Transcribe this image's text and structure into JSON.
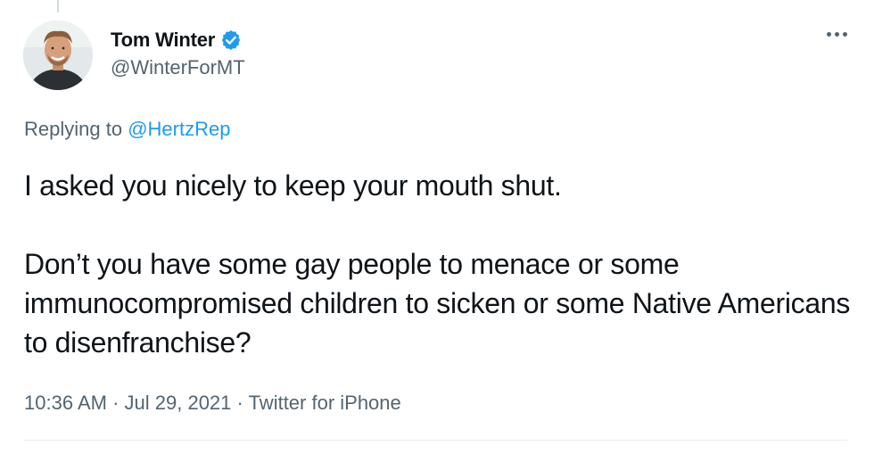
{
  "tweet": {
    "author": {
      "name": "Tom Winter",
      "handle": "@WinterForMT",
      "verified_icon": "verified-badge-icon",
      "avatar_icon": "profile-photo"
    },
    "replying_prefix": "Replying to",
    "replying_to": "@HertzRep",
    "paragraphs": [
      "I asked you nicely to keep your mouth shut.",
      "Don’t you have some gay people to menace or some immunocompromised children to sicken or some Native Americans to disenfranchise?"
    ],
    "meta": {
      "time": "10:36 AM",
      "date": "Jul 29, 2021",
      "source": "Twitter for iPhone",
      "separator": "·"
    },
    "more_icon": "more-options-icon"
  },
  "colors": {
    "text": "#0f1419",
    "secondary": "#536471",
    "accent": "#1d9bf0",
    "divider": "#e6ecf0"
  }
}
